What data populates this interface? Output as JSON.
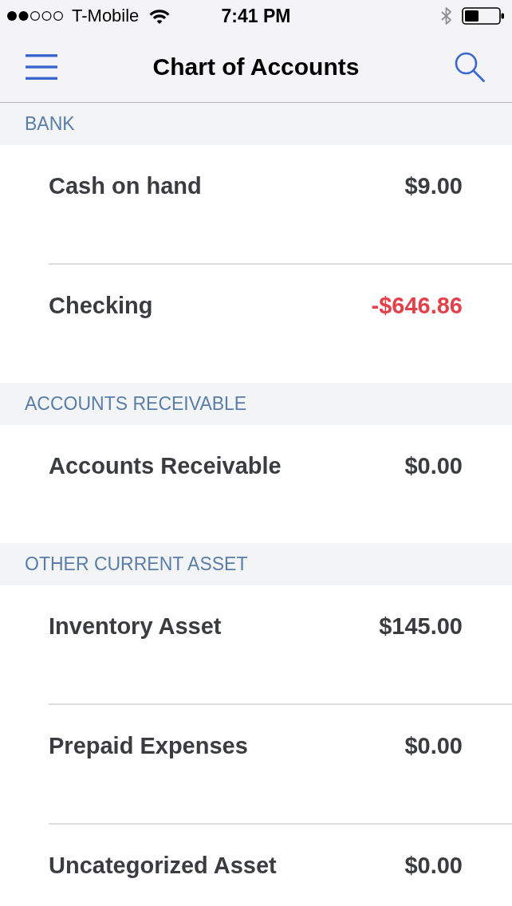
{
  "status_bar": {
    "carrier": "T-Mobile",
    "time": "7:41 PM"
  },
  "nav_bar": {
    "title": "Chart of Accounts"
  },
  "sections": [
    {
      "title": "BANK",
      "accounts": [
        {
          "name": "Cash on hand",
          "balance": "$9.00",
          "negative": false
        },
        {
          "name": "Checking",
          "balance": "-$646.86",
          "negative": true
        }
      ]
    },
    {
      "title": "ACCOUNTS RECEIVABLE",
      "accounts": [
        {
          "name": "Accounts Receivable",
          "balance": "$0.00",
          "negative": false
        }
      ]
    },
    {
      "title": "OTHER CURRENT ASSET",
      "accounts": [
        {
          "name": "Inventory Asset",
          "balance": "$145.00",
          "negative": false
        },
        {
          "name": "Prepaid Expenses",
          "balance": "$0.00",
          "negative": false
        },
        {
          "name": "Uncategorized Asset",
          "balance": "$0.00",
          "negative": false
        }
      ]
    }
  ]
}
